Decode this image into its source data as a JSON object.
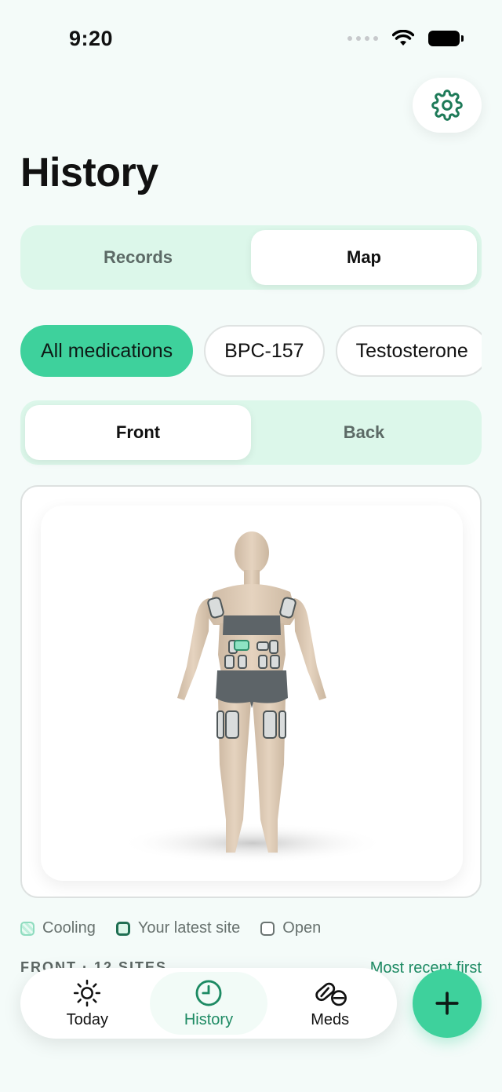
{
  "status_bar": {
    "time": "9:20"
  },
  "header": {
    "title": "History"
  },
  "view_toggle": {
    "options": [
      "Records",
      "Map"
    ],
    "selected": "Map"
  },
  "filters": {
    "chips": [
      "All medications",
      "BPC-157",
      "Testosterone"
    ],
    "selected": "All medications"
  },
  "side_toggle": {
    "options": [
      "Front",
      "Back"
    ],
    "selected": "Front"
  },
  "legend": {
    "cooling": "Cooling",
    "latest": "Your latest site",
    "open": "Open"
  },
  "sites_section": {
    "heading": "FRONT · 12 SITES",
    "sort": "Most recent first"
  },
  "tab_bar": {
    "tabs": [
      "Today",
      "History",
      "Meds"
    ],
    "active": "History"
  },
  "colors": {
    "accent": "#3ed19c",
    "accent_dark": "#1d8a63",
    "background": "#f4fbf9",
    "segment_bg": "#dcf7ea"
  },
  "icons": [
    "gear-icon",
    "sun-icon",
    "clock-icon",
    "pill-icon",
    "plus-icon",
    "wifi-icon",
    "battery-icon"
  ]
}
